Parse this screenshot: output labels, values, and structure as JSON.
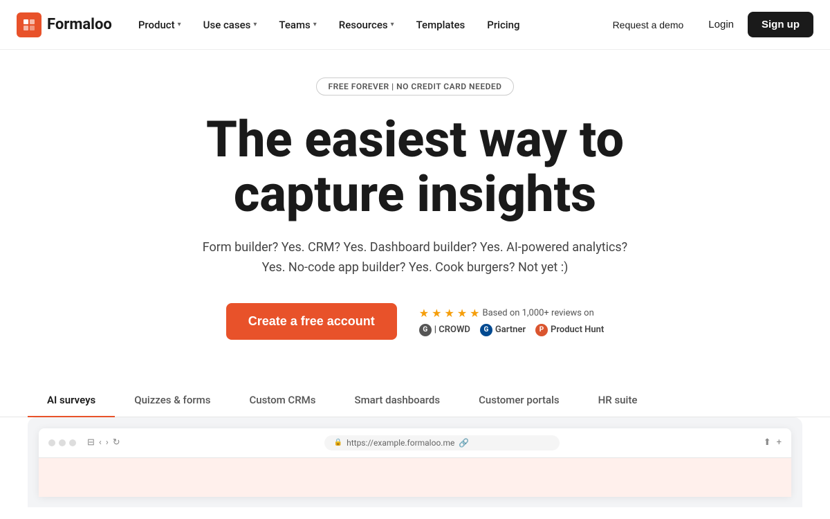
{
  "logo": {
    "icon_letter": "F",
    "text": "Formaloo"
  },
  "nav": {
    "items": [
      {
        "label": "Product",
        "has_dropdown": true
      },
      {
        "label": "Use cases",
        "has_dropdown": true
      },
      {
        "label": "Teams",
        "has_dropdown": true
      },
      {
        "label": "Resources",
        "has_dropdown": true
      },
      {
        "label": "Templates",
        "has_dropdown": false
      },
      {
        "label": "Pricing",
        "has_dropdown": false
      }
    ],
    "request_demo": "Request a demo",
    "login": "Login",
    "signup": "Sign up"
  },
  "hero": {
    "badge": "FREE FOREVER | NO CREDIT CARD NEEDED",
    "title_line1": "The easiest way to",
    "title_line2": "capture insights",
    "subtitle": "Form builder? Yes. CRM? Yes. Dashboard builder? Yes. AI-powered analytics? Yes. No-code app builder? Yes. Cook burgers? Not yet :)",
    "cta_button": "Create a free account",
    "reviews": {
      "text": "Based on 1,000+ reviews on",
      "stars": 5,
      "logos": [
        {
          "name": "CROWD",
          "abbr": "G"
        },
        {
          "name": "Gartner",
          "abbr": "G"
        },
        {
          "name": "Product Hunt",
          "abbr": "P"
        }
      ]
    }
  },
  "tabs": [
    {
      "label": "AI surveys",
      "active": true
    },
    {
      "label": "Quizzes & forms",
      "active": false
    },
    {
      "label": "Custom CRMs",
      "active": false
    },
    {
      "label": "Smart dashboards",
      "active": false
    },
    {
      "label": "Customer portals",
      "active": false
    },
    {
      "label": "HR suite",
      "active": false
    }
  ],
  "browser": {
    "url": "https://example.formaloo.me"
  }
}
